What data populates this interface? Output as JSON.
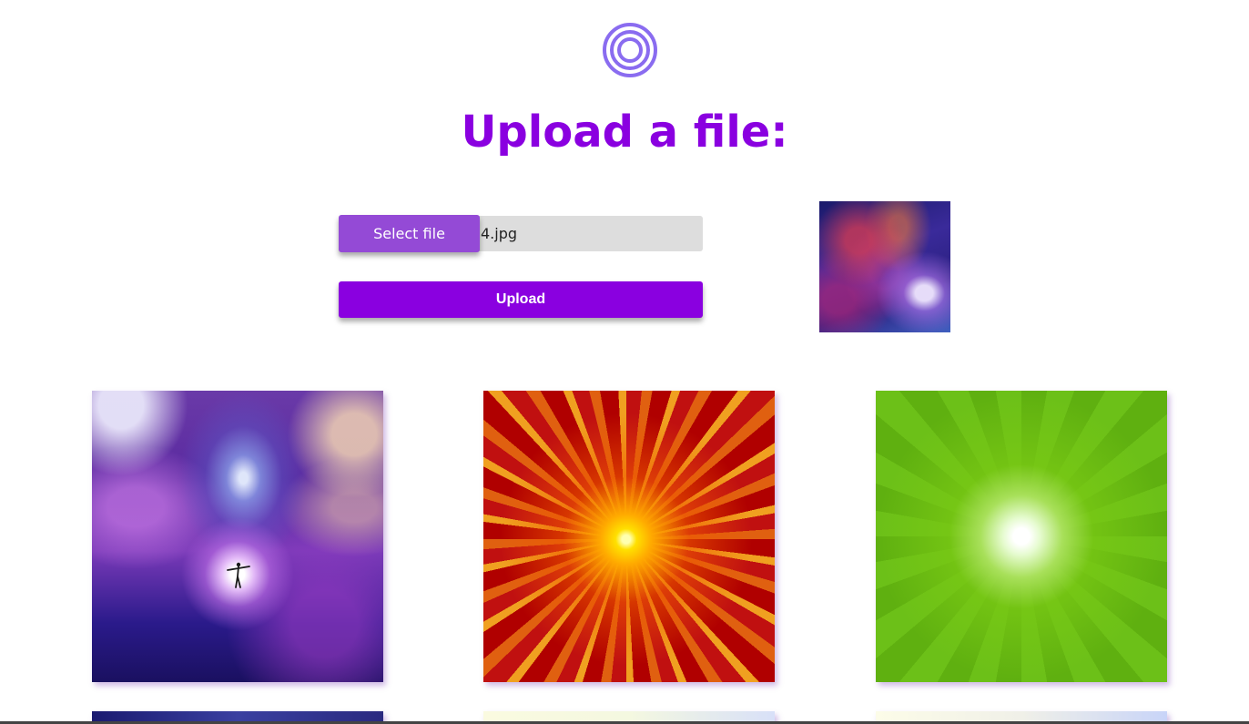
{
  "header": {
    "logo_icon": "concentric-circles-icon",
    "title": "Upload a file:"
  },
  "form": {
    "select_label": "Select file",
    "file_name": "4.jpg",
    "upload_label": "Upload"
  },
  "colors": {
    "accent": "#8a00e0",
    "select_button": "#944ad6",
    "file_field": "#dddddd"
  },
  "gallery": {
    "images": [
      {
        "name": "galaxy-dancer-image"
      },
      {
        "name": "red-burst-image"
      },
      {
        "name": "green-burst-image"
      }
    ]
  }
}
